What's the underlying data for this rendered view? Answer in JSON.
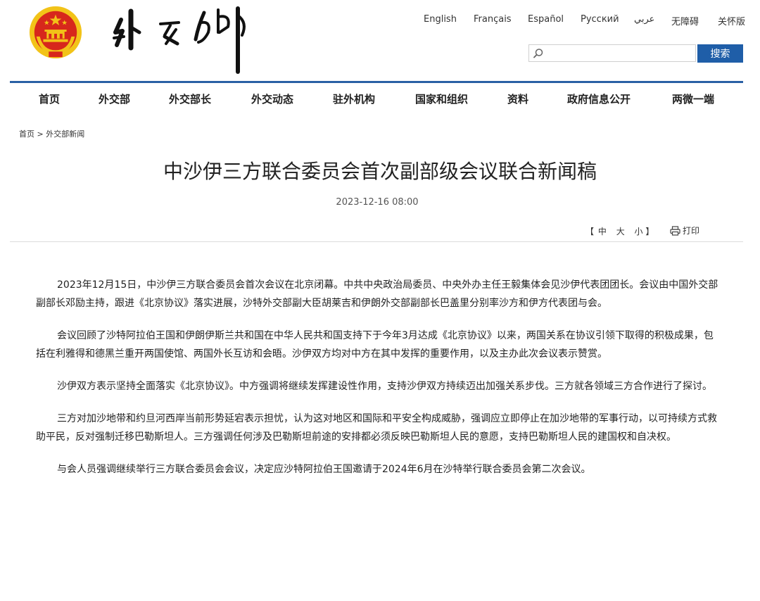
{
  "header": {
    "languages": [
      "English",
      "Français",
      "Español",
      "Русский",
      "عربي",
      "无障碍",
      "关怀版"
    ],
    "search": {
      "placeholder": "",
      "button_label": "搜索"
    }
  },
  "nav": {
    "items": [
      "首页",
      "外交部",
      "外交部长",
      "外交动态",
      "驻外机构",
      "国家和组织",
      "资料",
      "政府信息公开",
      "两微一端"
    ]
  },
  "breadcrumb": {
    "home": "首页",
    "separator": " > ",
    "current": "外交部新闻"
  },
  "article": {
    "title": "中沙伊三方联合委员会首次副部级会议联合新闻稿",
    "date": "2023-12-16 08:00",
    "font_size_controls": {
      "open": "【",
      "large": "中",
      "medium": "大",
      "small": "小",
      "close": "】"
    },
    "print_label": "打印",
    "paragraphs": [
      "2023年12月15日，中沙伊三方联合委员会首次会议在北京闭幕。中共中央政治局委员、中央外办主任王毅集体会见沙伊代表团团长。会议由中国外交部副部长邓励主持，跟进《北京协议》落实进展，沙特外交部副大臣胡莱吉和伊朗外交部副部长巴盖里分别率沙方和伊方代表团与会。",
      "会议回顾了沙特阿拉伯王国和伊朗伊斯兰共和国在中华人民共和国支持下于今年3月达成《北京协议》以来，两国关系在协议引领下取得的积极成果，包括在利雅得和德黑兰重开两国使馆、两国外长互访和会晤。沙伊双方均对中方在其中发挥的重要作用，以及主办此次会议表示赞赏。",
      "沙伊双方表示坚持全面落实《北京协议》。中方强调将继续发挥建设性作用，支持沙伊双方持续迈出加强关系步伐。三方就各领域三方合作进行了探讨。",
      "三方对加沙地带和约旦河西岸当前形势延宕表示担忧，认为这对地区和国际和平安全构成威胁，强调应立即停止在加沙地带的军事行动，以可持续方式救助平民，反对强制迁移巴勒斯坦人。三方强调任何涉及巴勒斯坦前途的安排都必须反映巴勒斯坦人民的意愿，支持巴勒斯坦人民的建国权和自决权。",
      "与会人员强调继续举行三方联合委员会会议，决定应沙特阿拉伯王国邀请于2024年6月在沙特举行联合委员会第二次会议。"
    ]
  },
  "logo": {
    "calligraphy": "外交部"
  },
  "colors": {
    "accent": "#1f5ea8",
    "nav_line": "#2a61a5",
    "emblem_red": "#d7271c",
    "emblem_gold": "#f2c318"
  }
}
